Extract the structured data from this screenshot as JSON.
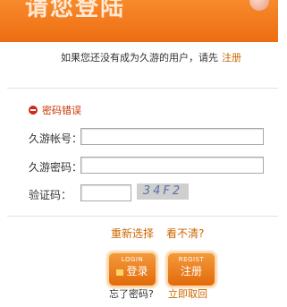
{
  "banner": {
    "title": "请您登陆"
  },
  "notice": {
    "text": "如果您还没有成为久游的用户，请先",
    "register_link": "注册"
  },
  "error": {
    "text": "密码错误"
  },
  "form": {
    "account_label": "久游帐号：",
    "password_label": "久游密码：",
    "captcha_label": "验证码：",
    "captcha_image_text": "34F2"
  },
  "links": {
    "reselect": "重新选择",
    "cant_see": "看不清?"
  },
  "buttons": {
    "login_small": "LOGIN",
    "login_label": "登录",
    "regist_small": "REGIST",
    "regist_label": "注册"
  },
  "footer": {
    "forgot": "忘了密码?",
    "retrieve": "立即取回"
  }
}
